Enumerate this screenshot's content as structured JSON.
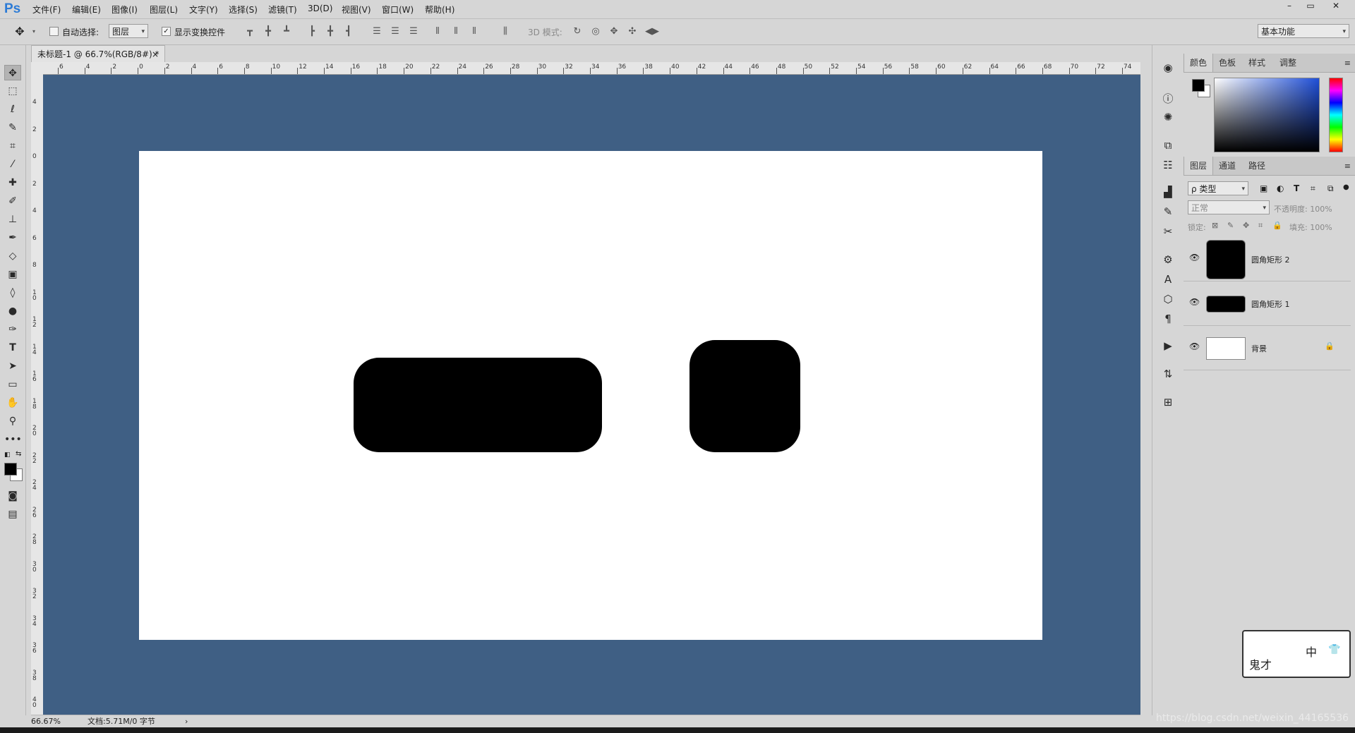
{
  "app": {
    "logo": "Ps"
  },
  "menu": [
    "文件(F)",
    "编辑(E)",
    "图像(I)",
    "图层(L)",
    "文字(Y)",
    "选择(S)",
    "滤镜(T)",
    "3D(D)",
    "视图(V)",
    "窗口(W)",
    "帮助(H)"
  ],
  "window_controls": {
    "minimize": "–",
    "restore": "▭",
    "close": "✕"
  },
  "options": {
    "auto_select_label": "自动选择:",
    "auto_select_value": "图层",
    "show_transform_label": "显示变换控件",
    "mode_3d_label": "3D 模式:",
    "workspace": "基本功能"
  },
  "document": {
    "tab_title": "未标题-1 @ 66.7%(RGB/8#) *",
    "close_icon": "×",
    "ruler_top": [
      "6",
      "4",
      "2",
      "0",
      "2",
      "4",
      "6",
      "8",
      "10",
      "12",
      "14",
      "16",
      "18",
      "20",
      "22",
      "24",
      "26",
      "28",
      "30",
      "32",
      "34",
      "36",
      "38",
      "40",
      "42",
      "44",
      "46",
      "48",
      "50",
      "52",
      "54",
      "56",
      "58",
      "60",
      "62",
      "64",
      "66",
      "68",
      "70",
      "72",
      "74"
    ],
    "ruler_left": [
      "4",
      "2",
      "0",
      "2",
      "4",
      "6",
      "8",
      "1 0",
      "1 2",
      "1 4",
      "1 6",
      "1 8",
      "2 0",
      "2 2",
      "2 4",
      "2 6",
      "2 8",
      "3 0",
      "3 2",
      "3 4",
      "3 6",
      "3 8",
      "4 0"
    ]
  },
  "status": {
    "zoom": "66.67%",
    "doc_info": "文档:5.71M/0 字节",
    "arrow": "›"
  },
  "panels": {
    "color_tabs": [
      "颜色",
      "色板",
      "样式",
      "调整"
    ],
    "layers_tabs": [
      "图层",
      "通道",
      "路径"
    ],
    "filter_kind": "ρ 类型",
    "blend_mode": "正常",
    "opacity_label": "不透明度: 100%",
    "lock_label": "锁定:",
    "fill_label": "填充: 100%",
    "layers": [
      {
        "name": "圆角矩形 2"
      },
      {
        "name": "圆角矩形 1"
      },
      {
        "name": "背景"
      }
    ]
  },
  "overlay": {
    "watermark": "https://blog.csdn.net/weixin_44165536",
    "badge_face": "鬼才",
    "badge_ime": "中"
  },
  "colors": {
    "pasteboard": "#3f5f84",
    "foreground": "#000000",
    "background": "#ffffff"
  }
}
